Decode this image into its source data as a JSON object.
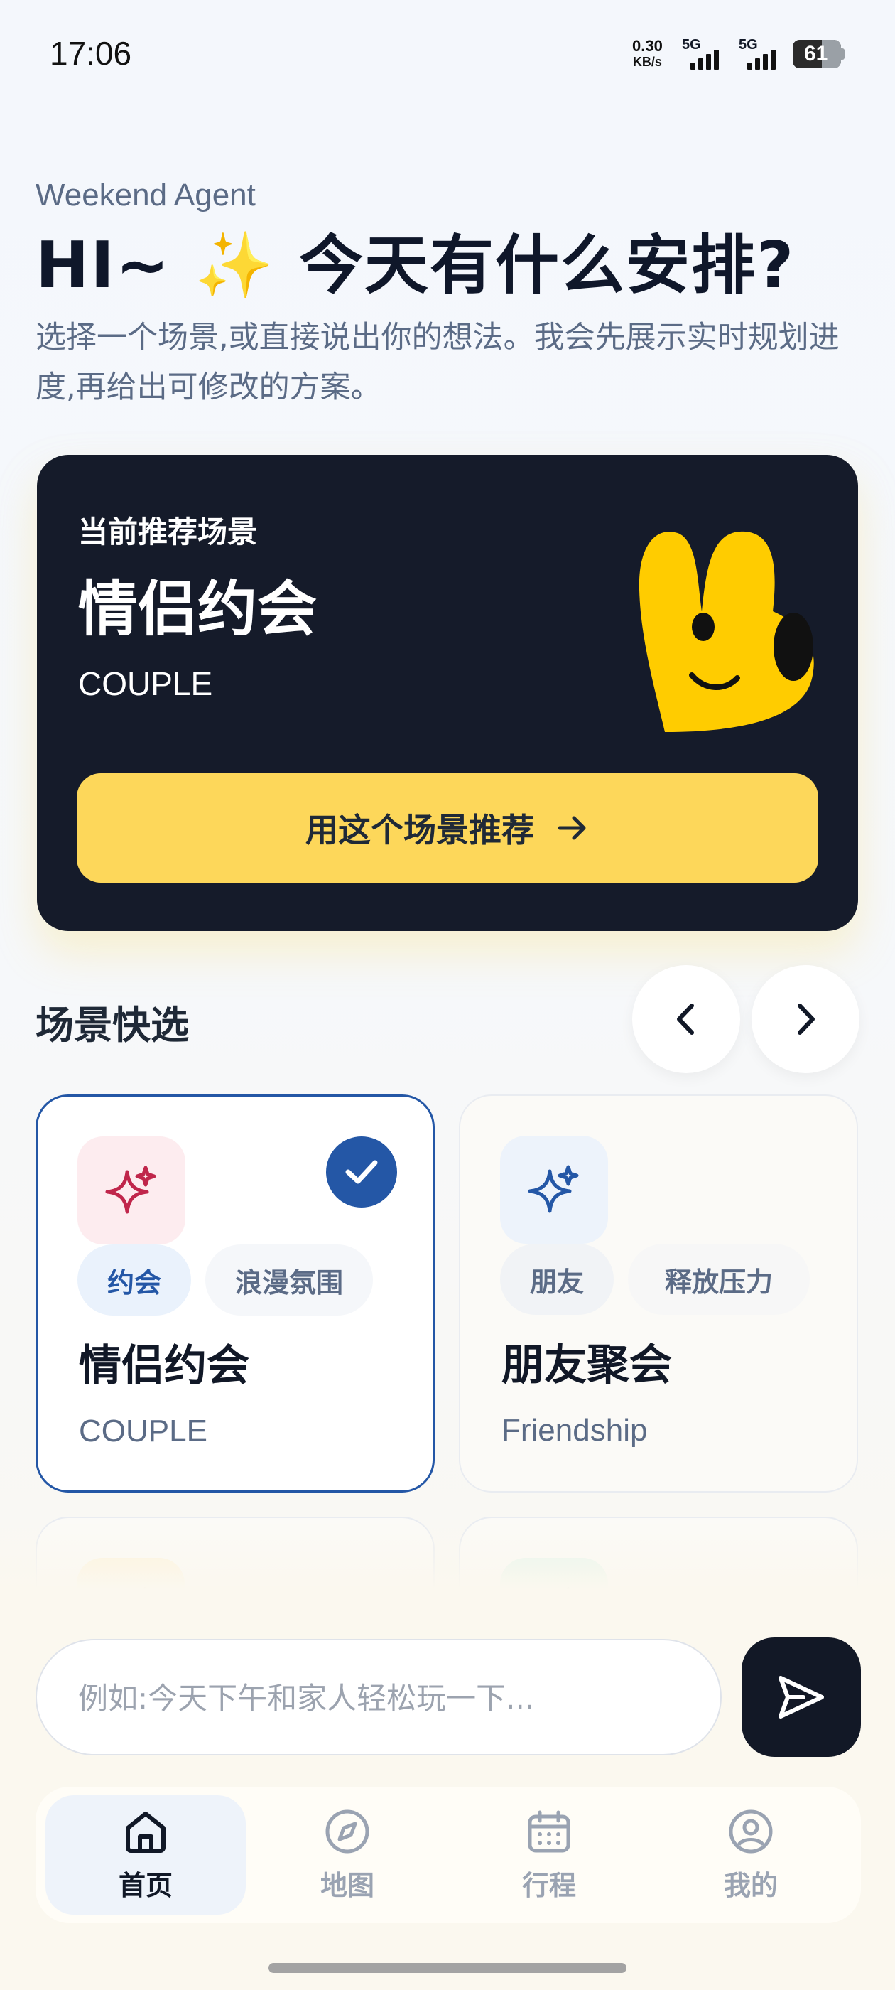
{
  "status_bar": {
    "time": "17:06",
    "net_speed_value": "0.30",
    "net_speed_unit": "KB/s",
    "sim1_label": "5G",
    "sim2_label": "5G",
    "battery": "61"
  },
  "header": {
    "app_label": "Weekend Agent",
    "greeting": "HI~ ✨ 今天有什么安排?",
    "subtitle": "选择一个场景,或直接说出你的想法。我会先展示实时规划进度,再给出可修改的方案。"
  },
  "hero": {
    "kicker": "当前推荐场景",
    "title": "情侣约会",
    "subtitle_en": "COUPLE",
    "button_label": "用这个场景推荐"
  },
  "quick_select": {
    "title": "场景快选",
    "cards": [
      {
        "name": "情侣约会",
        "name_en": "COUPLE",
        "tags": [
          "约会",
          "浪漫氛围"
        ],
        "selected": true,
        "icon": "sparkle-icon",
        "icon_color": "#c0264b",
        "tile_color": "#fdecef"
      },
      {
        "name": "朋友聚会",
        "name_en": "Friendship",
        "tags": [
          "朋友",
          "释放压力"
        ],
        "selected": false,
        "icon": "sparkle-icon",
        "icon_color": "#2457a6",
        "tile_color": "#edf3fb"
      },
      {
        "icon": "sparkle-icon",
        "icon_color": "#a66a00",
        "tile_color": "#fdf2d7"
      },
      {
        "icon": "sparkle-icon",
        "icon_color": "#0f7a52",
        "tile_color": "#e3f5ec"
      }
    ]
  },
  "composer": {
    "placeholder": "例如:今天下午和家人轻松玩一下..."
  },
  "tabbar": {
    "items": [
      {
        "label": "首页",
        "icon": "home-icon",
        "active": true
      },
      {
        "label": "地图",
        "icon": "compass-icon",
        "active": false
      },
      {
        "label": "行程",
        "icon": "calendar-icon",
        "active": false
      },
      {
        "label": "我的",
        "icon": "profile-icon",
        "active": false
      }
    ]
  },
  "colors": {
    "accent": "#2457a6",
    "hero_bg": "#151b2a",
    "hero_button": "#fdd75a",
    "mascot": "#ffcc00"
  }
}
